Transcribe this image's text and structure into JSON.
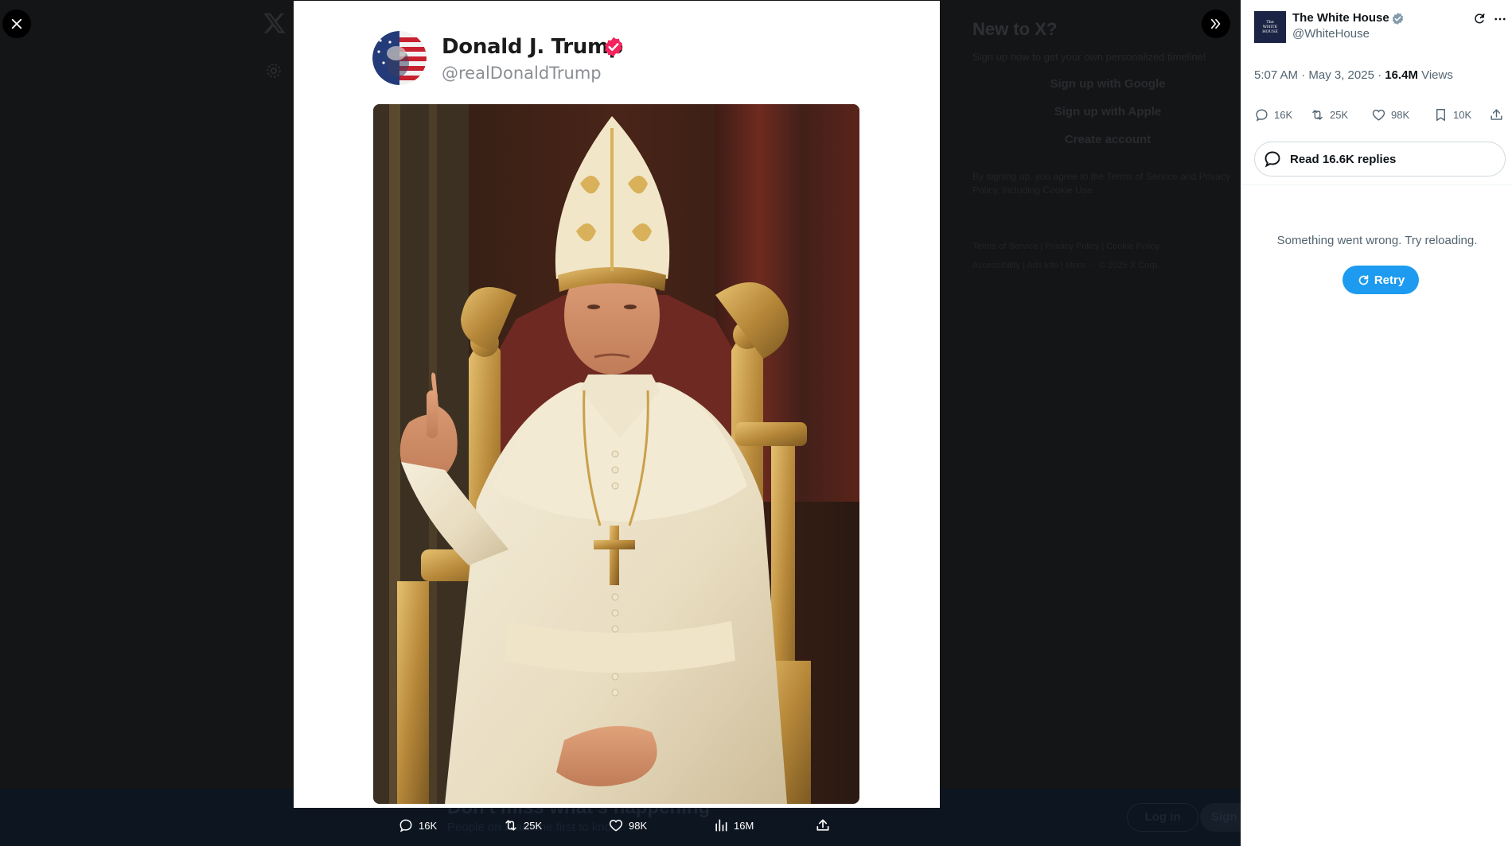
{
  "background_page": {
    "signup_title": "New to X?",
    "signup_sub": "Sign up now to get your own personalized timeline!",
    "google_label": "Sign up with Google",
    "apple_label": "Sign up with Apple",
    "create_label": "Create account",
    "legal_text": "By signing up, you agree to the Terms of Service and Privacy Policy, including Cookie Use.",
    "footer_line1": "Terms of Service  |  Privacy Policy  |  Cookie Policy",
    "footer_line2": "Accessibility  |  Ads info  |  More ···  © 2025 X Corp.",
    "banner_title": "Don't miss what's happening",
    "banner_sub": "People on X are the first to know.",
    "login_label": "Log in",
    "signup_label": "Sign up"
  },
  "media": {
    "author_name": "Donald J. Trump",
    "author_handle": "@realDonaldTrump",
    "image_alt": "Donald Trump dressed as the pope seated on a golden throne"
  },
  "media_actions": {
    "replies": "16K",
    "reposts": "25K",
    "likes": "98K",
    "views": "16M"
  },
  "post": {
    "author_name": "The White House",
    "author_handle": "@WhiteHouse",
    "logo_lines": [
      "The",
      "WHITE",
      "HOUSE"
    ],
    "time": "5:07 AM · May 3, 2025 · ",
    "views_count": "16.4M",
    "views_label": " Views",
    "replies": "16K",
    "reposts": "25K",
    "likes": "98K",
    "bookmarks": "10K"
  },
  "read_replies_label": "Read 16.6K replies",
  "error_text": "Something went wrong. Try reloading.",
  "retry_label": "Retry",
  "colors": {
    "accent": "#1d9bf0",
    "viewer_bg": "#141517",
    "trump_badge": "#f4245e",
    "gov_badge": "#829aab"
  },
  "icons": [
    "close-icon",
    "x-logo-icon",
    "gear-icon",
    "expand-panel-icon",
    "reply-icon",
    "repost-icon",
    "like-icon",
    "views-icon",
    "share-icon",
    "bookmark-icon",
    "grok-icon",
    "more-icon",
    "retry-icon",
    "verified-badge-icon"
  ]
}
